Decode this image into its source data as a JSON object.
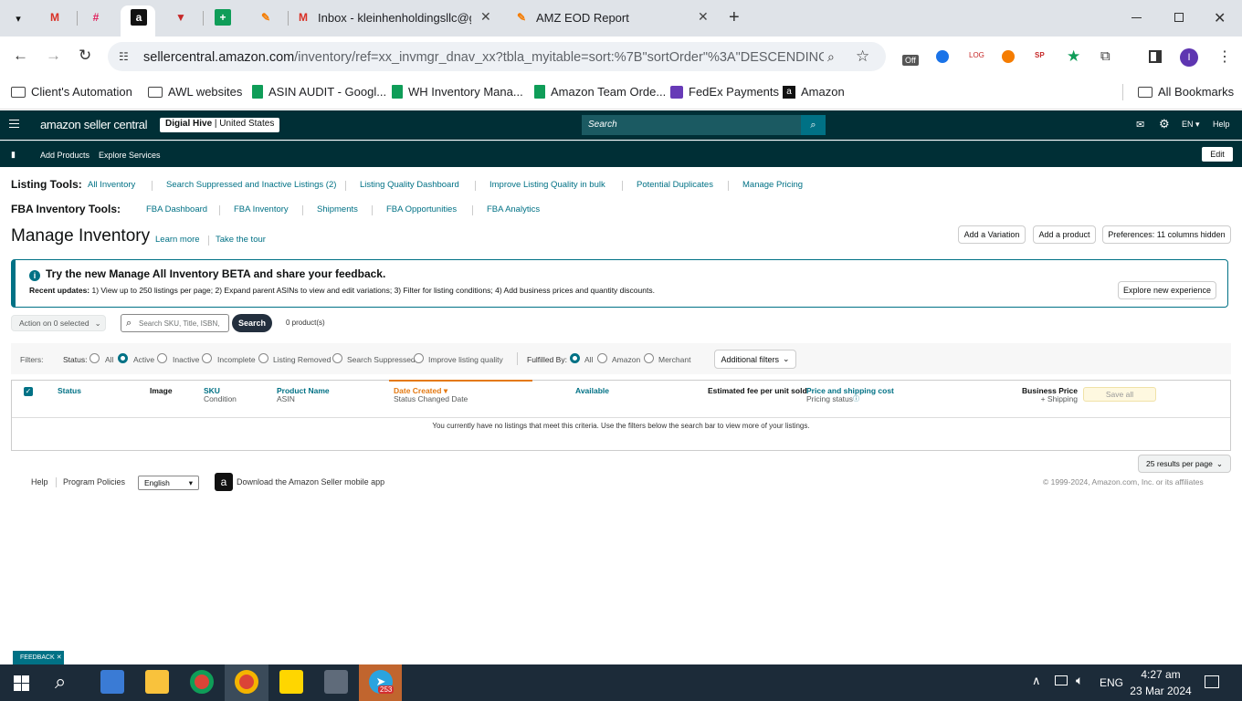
{
  "browser": {
    "tabs": [
      {
        "icon": "gmail-icon",
        "title": ""
      },
      {
        "icon": "slack-icon",
        "title": ""
      },
      {
        "icon": "amazon-icon",
        "title": ""
      },
      {
        "icon": "v-icon",
        "title": ""
      },
      {
        "icon": "sheets-icon",
        "title": ""
      },
      {
        "icon": "app-icon",
        "title": ""
      },
      {
        "icon": "gmail-icon",
        "title": "Inbox - kleinhenholdingsllc@gr"
      },
      {
        "icon": "amazon-icon",
        "title": "AMZ EOD Report"
      }
    ],
    "url_host": "sellercentral.amazon.com",
    "url_path": "/inventory/ref=xx_invmgr_dnav_xx?tbla_myitable=sort:%7B\"sortOrder\"%3A\"DESCENDING\"%2...",
    "ext_badge": "Off",
    "profile_initial": "I",
    "bookmarks": [
      {
        "label": "Client's Automation",
        "icon": "folder"
      },
      {
        "label": "AWL websites",
        "icon": "folder"
      },
      {
        "label": "ASIN AUDIT - Googl...",
        "icon": "sheets"
      },
      {
        "label": "WH Inventory Mana...",
        "icon": "sheets"
      },
      {
        "label": "Amazon Team Orde...",
        "icon": "sheets"
      },
      {
        "label": "FedEx Payments",
        "icon": "forms"
      },
      {
        "label": "Amazon",
        "icon": "amazon"
      }
    ],
    "all_bookmarks": "All Bookmarks"
  },
  "header": {
    "logo": "amazon seller central",
    "store_name": "Digial Hive",
    "store_region": "United States",
    "search_placeholder": "Search",
    "lang": "EN",
    "help": "Help",
    "nav_items": [
      "Add Products",
      "Explore Services"
    ],
    "edit": "Edit"
  },
  "listing_tools": {
    "label": "Listing Tools:",
    "links": [
      "All Inventory",
      "Search Suppressed and Inactive Listings (2)",
      "Listing Quality Dashboard",
      "Improve Listing Quality in bulk",
      "Potential Duplicates",
      "Manage Pricing"
    ]
  },
  "fba_tools": {
    "label": "FBA Inventory Tools:",
    "links": [
      "FBA Dashboard",
      "FBA Inventory",
      "Shipments",
      "FBA Opportunities",
      "FBA Analytics"
    ]
  },
  "page": {
    "title": "Manage Inventory",
    "learn_more": "Learn more",
    "tour": "Take the tour",
    "add_variation": "Add a Variation",
    "add_product": "Add a product",
    "preferences": "Preferences: 11 columns hidden"
  },
  "beta": {
    "title": "Try the new Manage All Inventory BETA and share your feedback.",
    "updates_label": "Recent updates:",
    "updates_text": "1) View up to 250 listings per page; 2) Expand parent ASINs to view and edit variations; 3) Filter for listing conditions; 4) Add business prices and quantity discounts.",
    "button": "Explore new experience"
  },
  "actions": {
    "action_select": "Action on 0 selected",
    "search_placeholder": "Search SKU, Title, ISBN,",
    "search_button": "Search",
    "count": "0 product(s)"
  },
  "filters": {
    "label": "Filters:",
    "status_label": "Status:",
    "status_options": [
      "All",
      "Active",
      "Inactive",
      "Incomplete",
      "Listing Removed",
      "Search Suppressed",
      "Improve listing quality"
    ],
    "status_selected": "Active",
    "fulfilled_label": "Fulfilled By:",
    "fulfilled_options": [
      "All",
      "Amazon",
      "Merchant"
    ],
    "fulfilled_selected": "All",
    "additional": "Additional filters"
  },
  "table": {
    "columns": {
      "status": "Status",
      "image": "Image",
      "sku": "SKU",
      "condition": "Condition",
      "product_name": "Product Name",
      "asin": "ASIN",
      "date_created": "Date Created",
      "status_changed": "Status Changed Date",
      "available": "Available",
      "fee": "Estimated fee per unit sold",
      "price": "Price and shipping cost",
      "pricing_status": "Pricing status",
      "business_price": "Business Price",
      "shipping": "+ Shipping"
    },
    "save_all": "Save all",
    "empty_message": "You currently have no listings that meet this criteria. Use the filters below the search bar to view more of your listings."
  },
  "pagination": {
    "per_page": "25 results per page"
  },
  "footer": {
    "help": "Help",
    "policies": "Program Policies",
    "language": "English",
    "app": "Download the Amazon Seller mobile app",
    "copyright": "© 1999-2024, Amazon.com, Inc. or its affiliates"
  },
  "feedback": "FEEDBACK",
  "taskbar": {
    "time": "4:27 am",
    "date": "23 Mar 2024",
    "lang": "ENG",
    "telegram_badge": "253"
  },
  "colors": {
    "nav_bg": "#002f36",
    "link": "#007185",
    "accent": "#e47911"
  }
}
